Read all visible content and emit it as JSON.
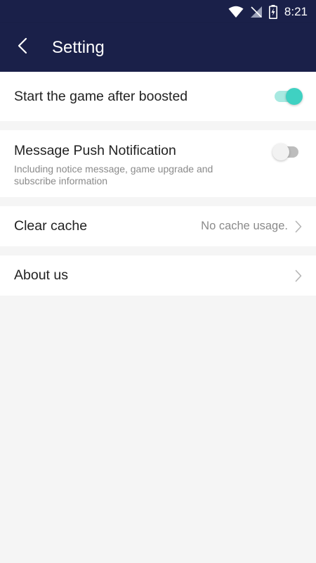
{
  "status_bar": {
    "time": "8:21",
    "icons": [
      "wifi-icon",
      "no-signal-icon",
      "battery-charging-icon"
    ]
  },
  "app_bar": {
    "back_icon": "chevron-left-icon",
    "title": "Setting"
  },
  "settings": {
    "start_after_boost": {
      "label": "Start the game after boosted",
      "enabled": true
    },
    "push_notification": {
      "label": "Message Push Notification",
      "description": "Including notice message, game upgrade and subscribe information",
      "enabled": false
    },
    "clear_cache": {
      "label": "Clear cache",
      "value": "No cache usage.",
      "icon": "chevron-right-icon"
    },
    "about_us": {
      "label": "About us",
      "icon": "chevron-right-icon"
    }
  },
  "colors": {
    "header": "#1a2049",
    "background": "#f5f5f5",
    "toggle_on": "#3fd1c2",
    "toggle_on_track": "#a8e9e1",
    "toggle_off_track": "#bdbdbd"
  }
}
